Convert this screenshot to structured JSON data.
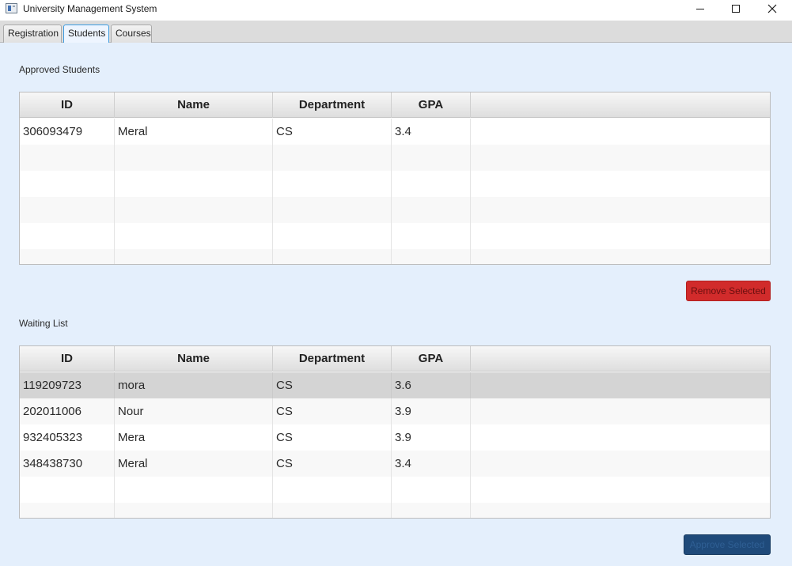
{
  "window": {
    "title": "University Management System"
  },
  "tabs": [
    {
      "label": "Registration"
    },
    {
      "label": "Students"
    },
    {
      "label": "Courses"
    }
  ],
  "active_tab": "Students",
  "approved": {
    "label": "Approved Students",
    "columns": [
      "ID",
      "Name",
      "Department",
      "GPA"
    ],
    "rows": [
      {
        "id": "306093479",
        "name": "Meral",
        "department": "CS",
        "gpa": "3.4"
      }
    ],
    "remove_button": "Remove Selected"
  },
  "waiting": {
    "label": "Waiting List",
    "columns": [
      "ID",
      "Name",
      "Department",
      "GPA"
    ],
    "rows": [
      {
        "id": "119209723",
        "name": "mora",
        "department": "CS",
        "gpa": "3.6"
      },
      {
        "id": "202011006",
        "name": "Nour",
        "department": "CS",
        "gpa": "3.9"
      },
      {
        "id": "932405323",
        "name": "Mera",
        "department": "CS",
        "gpa": "3.9"
      },
      {
        "id": "348438730",
        "name": "Meral",
        "department": "CS",
        "gpa": "3.4"
      }
    ],
    "selected_row": 0,
    "approve_button": "Approve Selected"
  },
  "colors": {
    "remove_button": "#d12b2b",
    "approve_button": "#1f4a7a",
    "content_background": "#e4effc",
    "active_tab_border": "#3c9be0"
  }
}
